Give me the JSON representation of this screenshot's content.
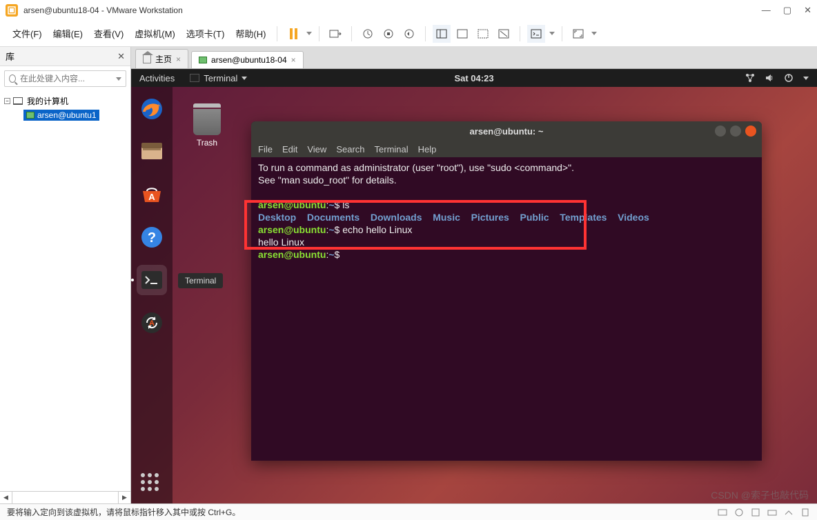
{
  "window": {
    "title": "arsen@ubuntu18-04 - VMware Workstation"
  },
  "menu": {
    "items": [
      "文件(F)",
      "编辑(E)",
      "查看(V)",
      "虚拟机(M)",
      "选项卡(T)",
      "帮助(H)"
    ]
  },
  "library": {
    "title": "库",
    "search_placeholder": "在此处键入内容...",
    "root": "我的计算机",
    "vm": "arsen@ubuntu1"
  },
  "tabs": {
    "home": "主页",
    "vm": "arsen@ubuntu18-04"
  },
  "ubuntu": {
    "activities": "Activities",
    "appmenu": "Terminal",
    "clock": "Sat 04:23",
    "trash": "Trash",
    "tooltip": "Terminal"
  },
  "terminal": {
    "title": "arsen@ubuntu: ~",
    "menu": [
      "File",
      "Edit",
      "View",
      "Search",
      "Terminal",
      "Help"
    ],
    "lines": {
      "l1": "To run a command as administrator (user \"root\"), use \"sudo <command>\".",
      "l2": "See \"man sudo_root\" for details.",
      "prompt_user": "arsen@ubuntu",
      "prompt_sep": ":",
      "prompt_path": "~",
      "prompt_end": "$",
      "cmd1": " ls",
      "dirs": [
        "Desktop",
        "Documents",
        "Downloads",
        "Music",
        "Pictures",
        "Public",
        "Templates",
        "Videos"
      ],
      "cmd2": " echo hello Linux",
      "out2": "hello Linux"
    }
  },
  "status": {
    "text": "要将输入定向到该虚拟机，请将鼠标指针移入其中或按 Ctrl+G。"
  },
  "watermark": "CSDN @索子也敲代码"
}
